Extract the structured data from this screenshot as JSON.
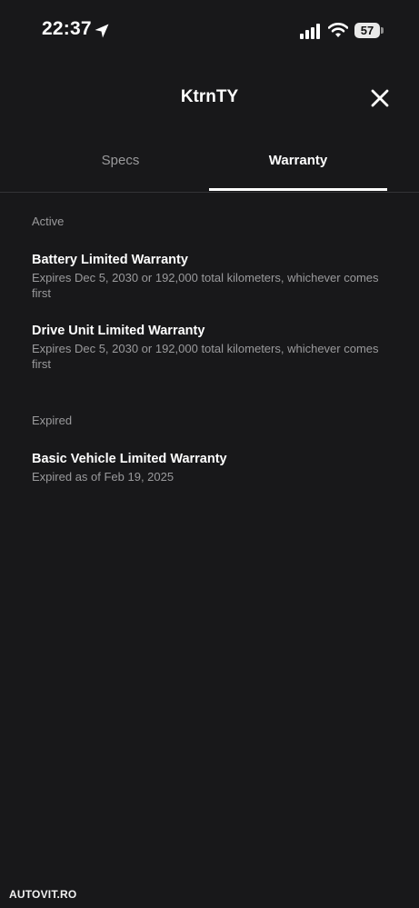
{
  "status_bar": {
    "time": "22:37",
    "battery_level": "57",
    "icons": [
      "location-arrow-icon",
      "cellular-signal-icon",
      "wifi-icon",
      "battery-icon"
    ]
  },
  "header": {
    "title": "KtrnTY",
    "close_icon": "close-icon"
  },
  "tabs": [
    {
      "label": "Specs",
      "active": false
    },
    {
      "label": "Warranty",
      "active": true
    }
  ],
  "sections": {
    "active": {
      "label": "Active",
      "items": [
        {
          "title": "Battery Limited Warranty",
          "subtitle": "Expires Dec 5, 2030 or 192,000 total kilometers, whichever comes first"
        },
        {
          "title": "Drive Unit Limited Warranty",
          "subtitle": "Expires Dec 5, 2030 or 192,000 total kilometers, whichever comes first"
        }
      ]
    },
    "expired": {
      "label": "Expired",
      "items": [
        {
          "title": "Basic Vehicle Limited Warranty",
          "subtitle": "Expired as of Feb 19, 2025"
        }
      ]
    }
  },
  "watermark": "AUTOVIT.RO",
  "colors": {
    "background": "#18181a",
    "text_primary": "#ffffff",
    "text_secondary": "#9a9a9c",
    "divider": "#333336"
  }
}
